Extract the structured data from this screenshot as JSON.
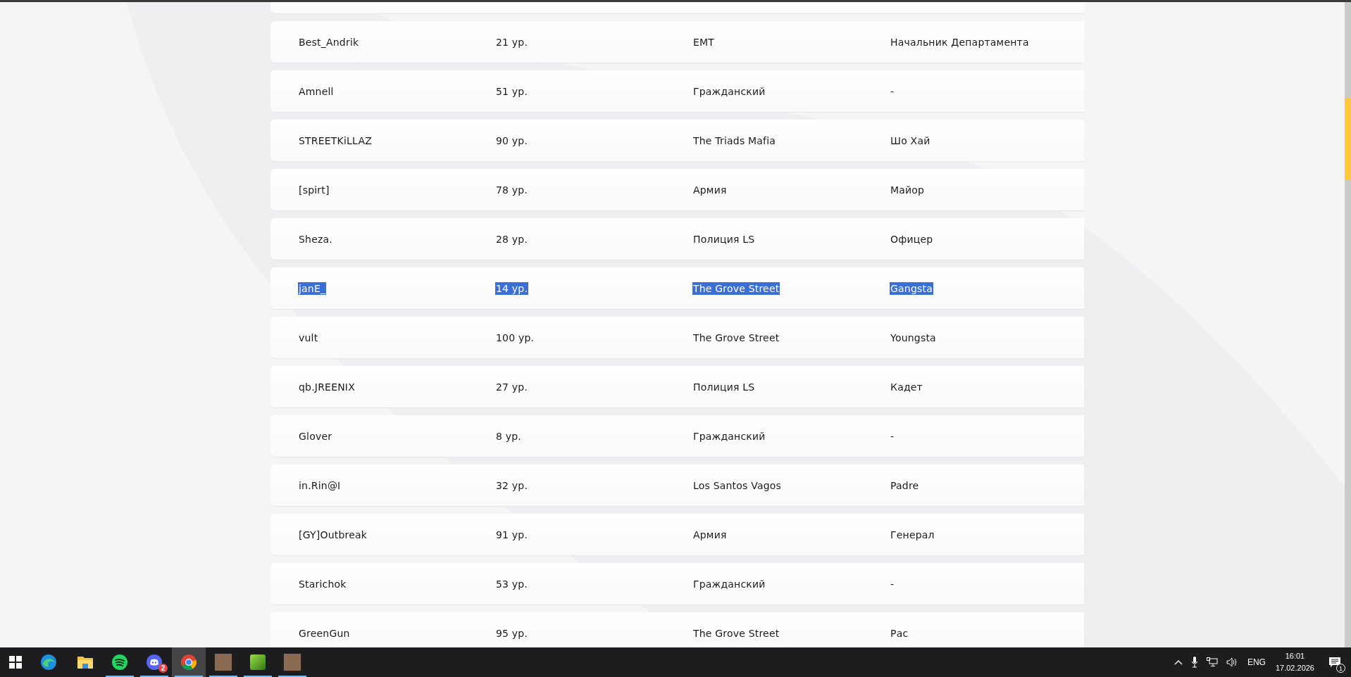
{
  "rows": [
    {
      "name": "Best_Andrik",
      "level_text": "21 ур.",
      "organization": "EMT",
      "rank": "Начальник Департамента",
      "selected": false
    },
    {
      "name": "Amnell",
      "level_text": "51 ур.",
      "organization": "Гражданский",
      "rank": "-",
      "selected": false
    },
    {
      "name": "STREETKiLLAZ",
      "level_text": "90 ур.",
      "organization": "The Triads Mafia",
      "rank": "Шо Хай",
      "selected": false
    },
    {
      "name": "[spirt]",
      "level_text": "78 ур.",
      "organization": "Армия",
      "rank": "Майор",
      "selected": false
    },
    {
      "name": "Sheza.",
      "level_text": "28 ур.",
      "organization": "Полиция LS",
      "rank": "Офицер",
      "selected": false
    },
    {
      "name": "janE_",
      "level_text": "14 ур.",
      "organization": "The Grove Street",
      "rank": "Gangsta",
      "selected": true
    },
    {
      "name": "vult",
      "level_text": "100 ур.",
      "organization": "The Grove Street",
      "rank": "Youngsta",
      "selected": false
    },
    {
      "name": "qb.JREENIX",
      "level_text": "27 ур.",
      "organization": "Полиция LS",
      "rank": "Кадет",
      "selected": false
    },
    {
      "name": "Glover",
      "level_text": "8 ур.",
      "organization": "Гражданский",
      "rank": "-",
      "selected": false
    },
    {
      "name": "in.Rin@I",
      "level_text": "32 ур.",
      "organization": "Los Santos Vagos",
      "rank": "Padre",
      "selected": false
    },
    {
      "name": "[GY]Outbreak",
      "level_text": "91 ур.",
      "organization": "Армия",
      "rank": "Генерал",
      "selected": false
    },
    {
      "name": "Starichok",
      "level_text": "53 ур.",
      "organization": "Гражданский",
      "rank": "-",
      "selected": false
    },
    {
      "name": "GreenGun",
      "level_text": "95 ур.",
      "organization": "The Grove Street",
      "rank": "Рас",
      "selected": false
    }
  ],
  "taskbar": {
    "apps": [
      {
        "kind": "edge",
        "running": false,
        "active": false
      },
      {
        "kind": "folder",
        "running": false,
        "active": false
      },
      {
        "kind": "spotify",
        "running": true,
        "active": false
      },
      {
        "kind": "discord",
        "running": true,
        "active": false,
        "badge": "2"
      },
      {
        "kind": "chrome",
        "running": true,
        "active": true
      },
      {
        "kind": "photo",
        "running": true,
        "active": false
      },
      {
        "kind": "green",
        "running": true,
        "active": false
      },
      {
        "kind": "photo",
        "running": true,
        "active": false
      }
    ],
    "language": "ENG",
    "time": "16:01",
    "date": "17.02.2026",
    "notification_count": "1"
  }
}
